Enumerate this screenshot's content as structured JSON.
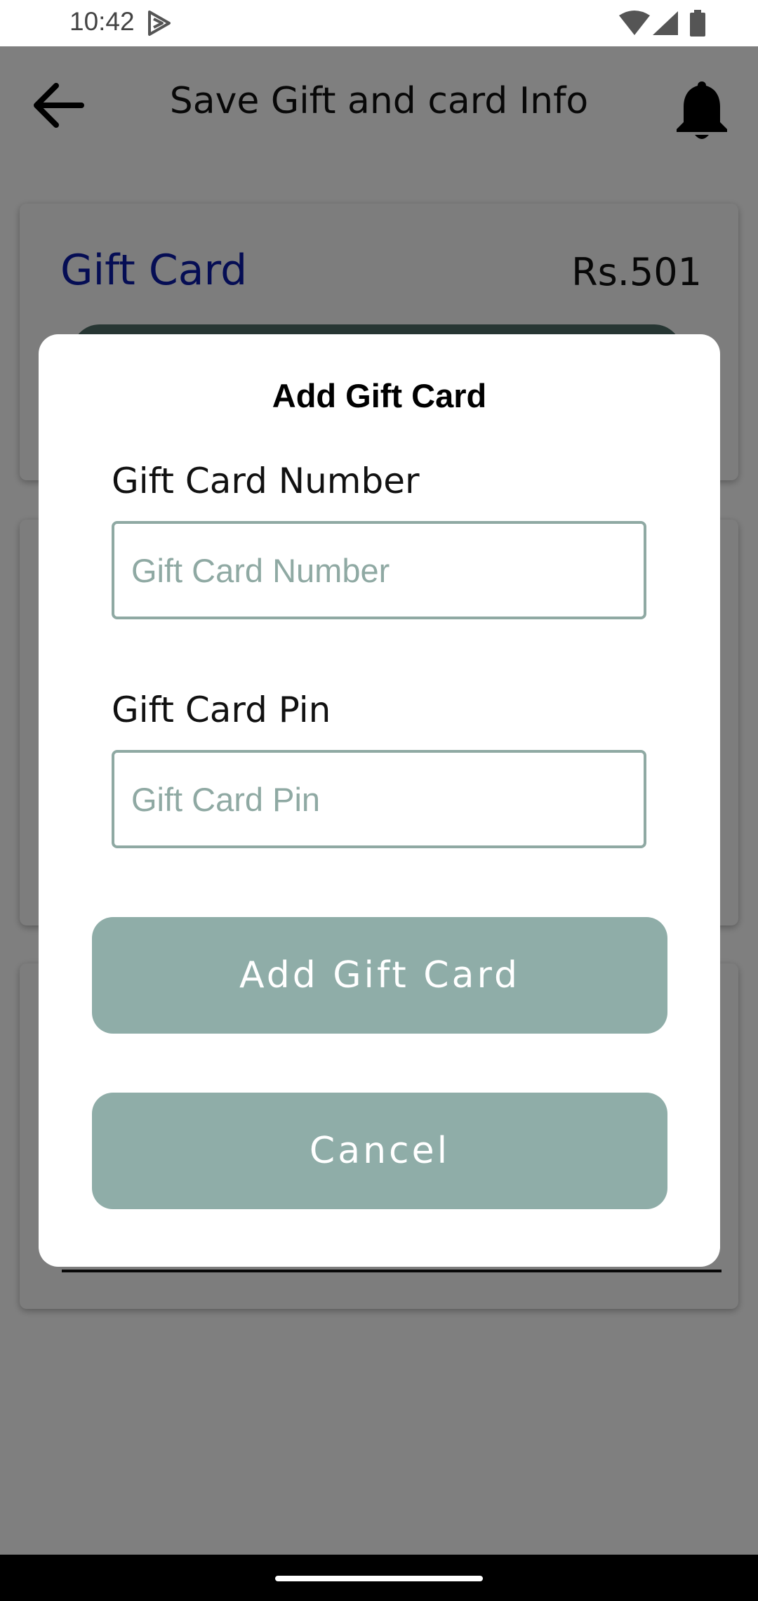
{
  "status_bar": {
    "time": "10:42",
    "icons": [
      "play-store-icon",
      "wifi-icon",
      "signal-icon",
      "battery-icon"
    ]
  },
  "app_bar": {
    "title": "Save Gift and card Info",
    "back_icon": "arrow-left-icon",
    "notification_icon": "bell-icon"
  },
  "background_card": {
    "title": "Gift Card",
    "amount": "Rs.501"
  },
  "dialog": {
    "title": "Add Gift Card",
    "number_label": "Gift Card Number",
    "number_placeholder": "Gift Card Number",
    "number_value": "",
    "pin_label": "Gift Card Pin",
    "pin_placeholder": "Gift Card Pin",
    "pin_value": "",
    "add_button": "Add Gift Card",
    "cancel_button": "Cancel"
  },
  "colors": {
    "accent_button": "#8fada8",
    "card_title": "#0a1aa8",
    "field_border": "#8fa9a3",
    "scrim": "rgba(0,0,0,0.5)"
  }
}
